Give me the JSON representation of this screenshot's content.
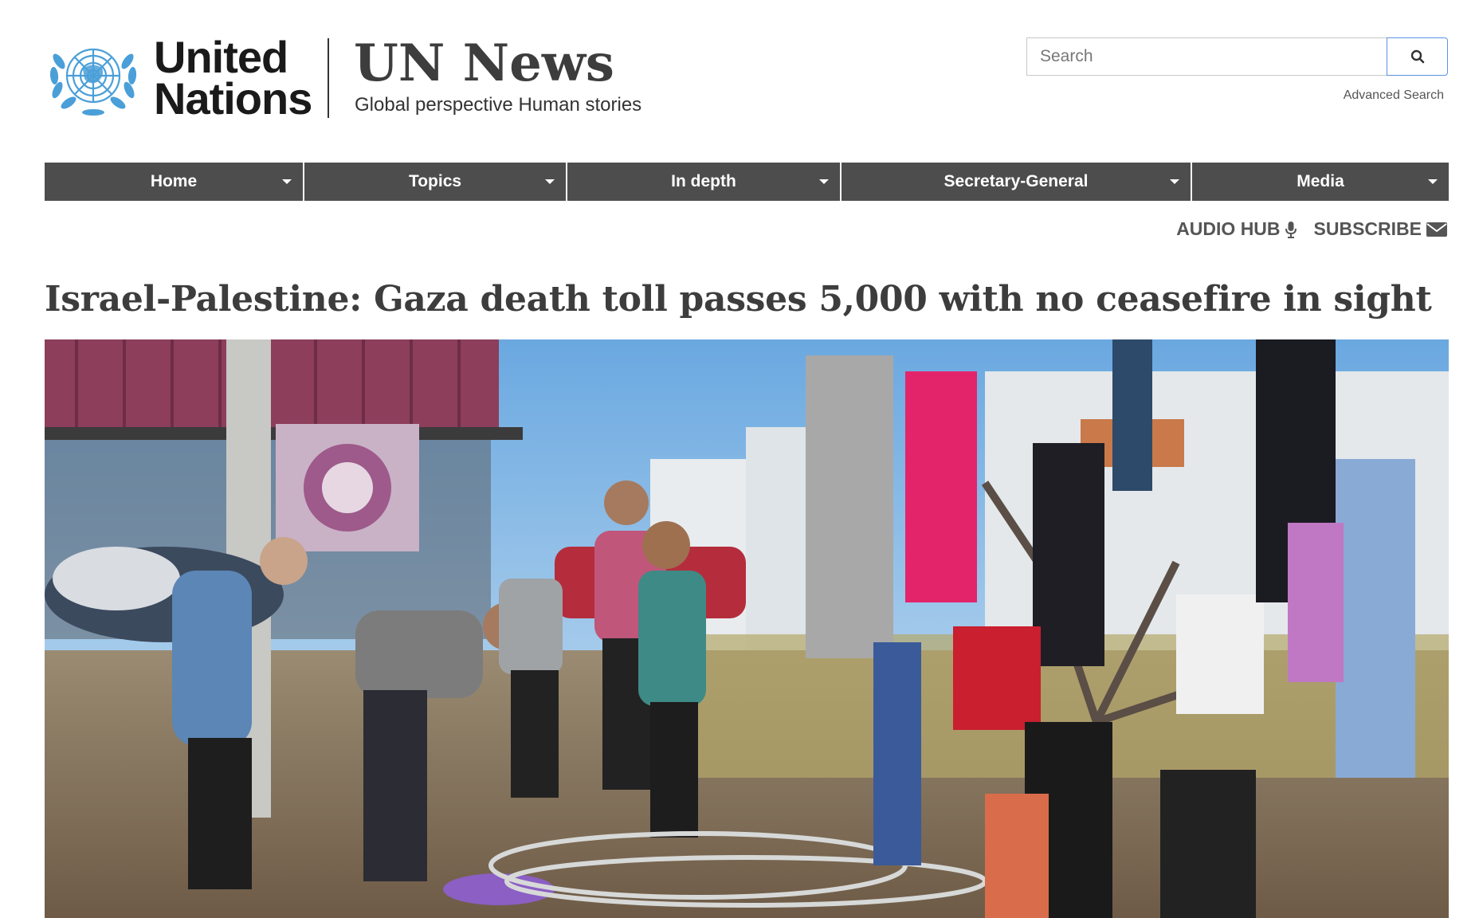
{
  "brand": {
    "un_line1": "United",
    "un_line2": "Nations",
    "site_title": "UN News",
    "tagline": "Global perspective Human stories"
  },
  "search": {
    "placeholder": "Search",
    "advanced_label": "Advanced Search"
  },
  "nav": {
    "items": [
      {
        "label": "Home"
      },
      {
        "label": "Topics"
      },
      {
        "label": "In depth"
      },
      {
        "label": "Secretary-General"
      },
      {
        "label": "Media"
      }
    ]
  },
  "utility": {
    "audio_hub": "AUDIO HUB",
    "subscribe": "SUBSCRIBE"
  },
  "article": {
    "headline": "Israel-Palestine: Gaza death toll passes 5,000 with no ceasefire in sight"
  },
  "colors": {
    "nav_bg": "#4d4d4d",
    "un_blue": "#4a9fd8",
    "title_gray": "#3d3d3d",
    "search_border_accent": "#5b92e5"
  },
  "icons": [
    "un-emblem-icon",
    "search-icon",
    "caret-down-icon",
    "microphone-icon",
    "envelope-icon"
  ]
}
